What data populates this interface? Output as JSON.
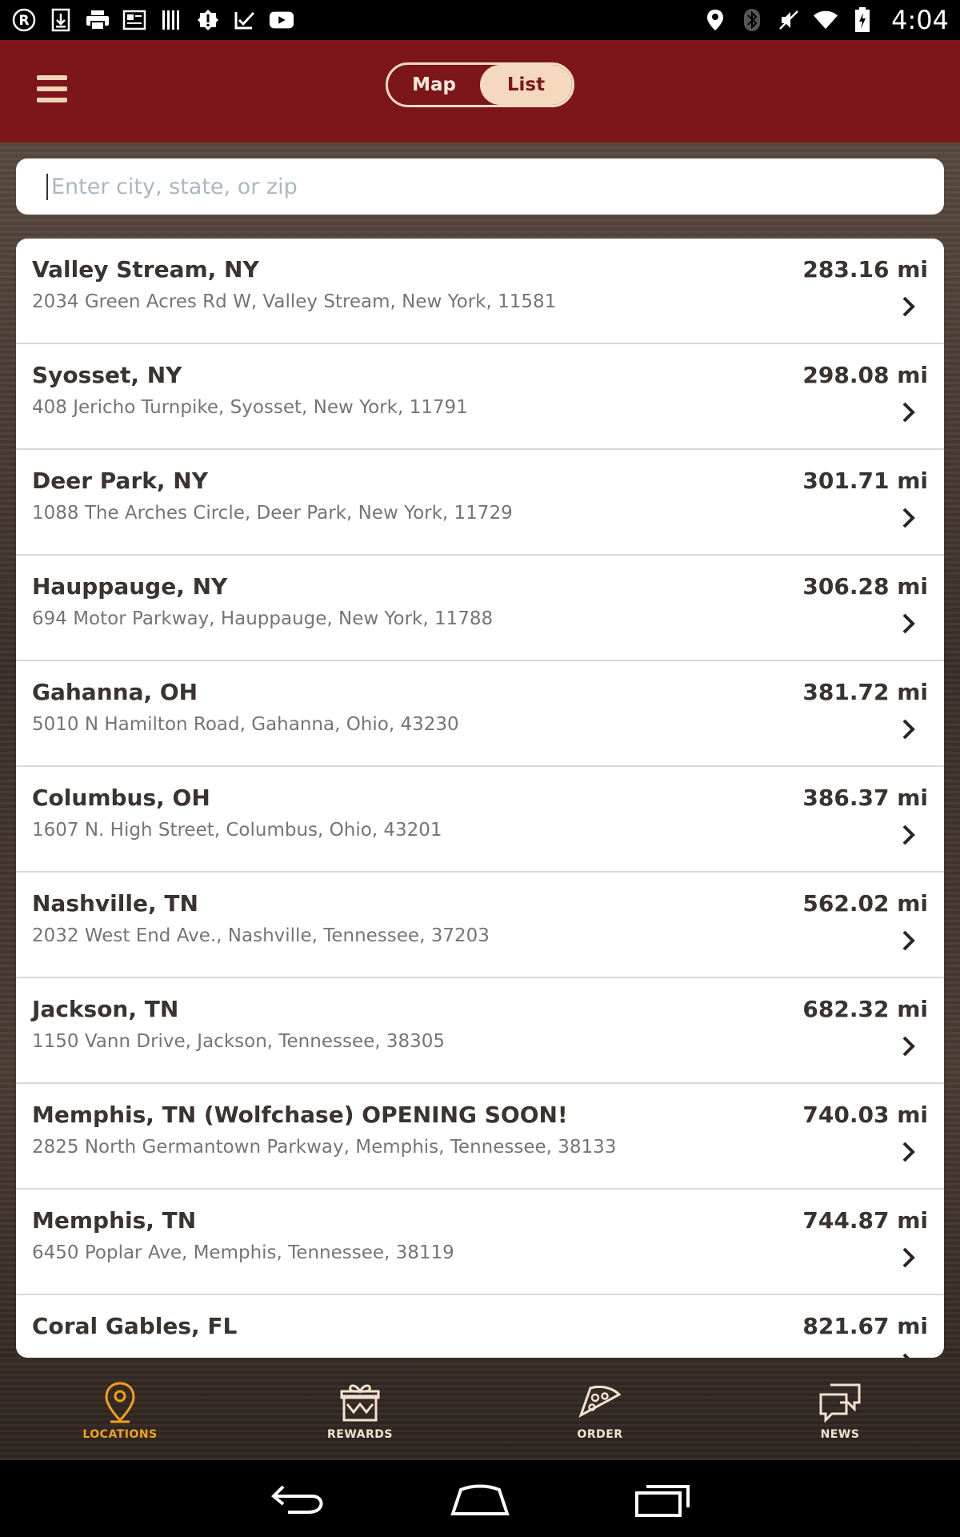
{
  "status_bar": {
    "time": "4:04",
    "left_icons": [
      "registered-icon",
      "download-icon",
      "print-icon",
      "news-icon",
      "barcode-icon",
      "alert-icon",
      "task-icon",
      "youtube-icon"
    ],
    "right_icons": [
      "location-icon",
      "bluetooth-icon",
      "mute-icon",
      "wifi-icon",
      "battery-icon"
    ]
  },
  "header": {
    "toggle": {
      "map_label": "Map",
      "list_label": "List",
      "active": "List"
    }
  },
  "search": {
    "placeholder": "Enter city, state, or zip",
    "value": ""
  },
  "locations": [
    {
      "title": "Valley Stream, NY",
      "address": "2034 Green Acres Rd W, Valley Stream, New York, 11581",
      "distance": "283.16 mi"
    },
    {
      "title": "Syosset, NY",
      "address": "408 Jericho Turnpike, Syosset, New York, 11791",
      "distance": "298.08 mi"
    },
    {
      "title": "Deer Park, NY",
      "address": "1088 The Arches Circle, Deer Park, New York, 11729",
      "distance": "301.71 mi"
    },
    {
      "title": "Hauppauge, NY",
      "address": "694 Motor Parkway, Hauppauge, New York, 11788",
      "distance": "306.28 mi"
    },
    {
      "title": "Gahanna, OH",
      "address": "5010 N Hamilton Road, Gahanna, Ohio, 43230",
      "distance": "381.72 mi"
    },
    {
      "title": "Columbus, OH",
      "address": "1607 N. High Street, Columbus, Ohio, 43201",
      "distance": "386.37 mi"
    },
    {
      "title": "Nashville, TN",
      "address": "2032 West End Ave., Nashville, Tennessee, 37203",
      "distance": "562.02 mi"
    },
    {
      "title": "Jackson, TN",
      "address": "1150 Vann Drive, Jackson, Tennessee, 38305",
      "distance": "682.32 mi"
    },
    {
      "title": "Memphis, TN (Wolfchase) OPENING SOON!",
      "address": "2825 North Germantown Parkway, Memphis, Tennessee, 38133",
      "distance": "740.03 mi"
    },
    {
      "title": "Memphis, TN",
      "address": "6450 Poplar Ave, Memphis, Tennessee, 38119",
      "distance": "744.87 mi"
    },
    {
      "title": "Coral Gables, FL",
      "address": "",
      "distance": "821.67 mi"
    }
  ],
  "bottom_nav": {
    "items": [
      {
        "label": "LOCATIONS",
        "icon": "location-pin-icon",
        "active": true
      },
      {
        "label": "REWARDS",
        "icon": "gift-box-icon",
        "active": false
      },
      {
        "label": "ORDER",
        "icon": "pizza-slice-icon",
        "active": false
      },
      {
        "label": "NEWS",
        "icon": "chat-bubbles-icon",
        "active": false
      }
    ],
    "active_color": "#f3a11a"
  },
  "colors": {
    "header": "#7d161a",
    "toggle_active": "#f4d9bf"
  }
}
